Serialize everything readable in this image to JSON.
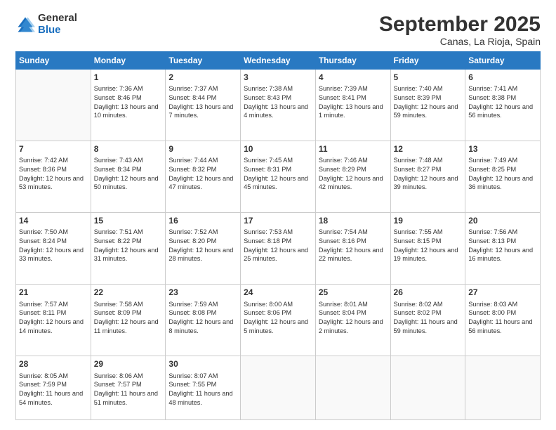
{
  "header": {
    "logo_general": "General",
    "logo_blue": "Blue",
    "title": "September 2025",
    "subtitle": "Canas, La Rioja, Spain"
  },
  "weekdays": [
    "Sunday",
    "Monday",
    "Tuesday",
    "Wednesday",
    "Thursday",
    "Friday",
    "Saturday"
  ],
  "weeks": [
    [
      {
        "day": "",
        "info": ""
      },
      {
        "day": "1",
        "info": "Sunrise: 7:36 AM\nSunset: 8:46 PM\nDaylight: 13 hours\nand 10 minutes."
      },
      {
        "day": "2",
        "info": "Sunrise: 7:37 AM\nSunset: 8:44 PM\nDaylight: 13 hours\nand 7 minutes."
      },
      {
        "day": "3",
        "info": "Sunrise: 7:38 AM\nSunset: 8:43 PM\nDaylight: 13 hours\nand 4 minutes."
      },
      {
        "day": "4",
        "info": "Sunrise: 7:39 AM\nSunset: 8:41 PM\nDaylight: 13 hours\nand 1 minute."
      },
      {
        "day": "5",
        "info": "Sunrise: 7:40 AM\nSunset: 8:39 PM\nDaylight: 12 hours\nand 59 minutes."
      },
      {
        "day": "6",
        "info": "Sunrise: 7:41 AM\nSunset: 8:38 PM\nDaylight: 12 hours\nand 56 minutes."
      }
    ],
    [
      {
        "day": "7",
        "info": "Sunrise: 7:42 AM\nSunset: 8:36 PM\nDaylight: 12 hours\nand 53 minutes."
      },
      {
        "day": "8",
        "info": "Sunrise: 7:43 AM\nSunset: 8:34 PM\nDaylight: 12 hours\nand 50 minutes."
      },
      {
        "day": "9",
        "info": "Sunrise: 7:44 AM\nSunset: 8:32 PM\nDaylight: 12 hours\nand 47 minutes."
      },
      {
        "day": "10",
        "info": "Sunrise: 7:45 AM\nSunset: 8:31 PM\nDaylight: 12 hours\nand 45 minutes."
      },
      {
        "day": "11",
        "info": "Sunrise: 7:46 AM\nSunset: 8:29 PM\nDaylight: 12 hours\nand 42 minutes."
      },
      {
        "day": "12",
        "info": "Sunrise: 7:48 AM\nSunset: 8:27 PM\nDaylight: 12 hours\nand 39 minutes."
      },
      {
        "day": "13",
        "info": "Sunrise: 7:49 AM\nSunset: 8:25 PM\nDaylight: 12 hours\nand 36 minutes."
      }
    ],
    [
      {
        "day": "14",
        "info": "Sunrise: 7:50 AM\nSunset: 8:24 PM\nDaylight: 12 hours\nand 33 minutes."
      },
      {
        "day": "15",
        "info": "Sunrise: 7:51 AM\nSunset: 8:22 PM\nDaylight: 12 hours\nand 31 minutes."
      },
      {
        "day": "16",
        "info": "Sunrise: 7:52 AM\nSunset: 8:20 PM\nDaylight: 12 hours\nand 28 minutes."
      },
      {
        "day": "17",
        "info": "Sunrise: 7:53 AM\nSunset: 8:18 PM\nDaylight: 12 hours\nand 25 minutes."
      },
      {
        "day": "18",
        "info": "Sunrise: 7:54 AM\nSunset: 8:16 PM\nDaylight: 12 hours\nand 22 minutes."
      },
      {
        "day": "19",
        "info": "Sunrise: 7:55 AM\nSunset: 8:15 PM\nDaylight: 12 hours\nand 19 minutes."
      },
      {
        "day": "20",
        "info": "Sunrise: 7:56 AM\nSunset: 8:13 PM\nDaylight: 12 hours\nand 16 minutes."
      }
    ],
    [
      {
        "day": "21",
        "info": "Sunrise: 7:57 AM\nSunset: 8:11 PM\nDaylight: 12 hours\nand 14 minutes."
      },
      {
        "day": "22",
        "info": "Sunrise: 7:58 AM\nSunset: 8:09 PM\nDaylight: 12 hours\nand 11 minutes."
      },
      {
        "day": "23",
        "info": "Sunrise: 7:59 AM\nSunset: 8:08 PM\nDaylight: 12 hours\nand 8 minutes."
      },
      {
        "day": "24",
        "info": "Sunrise: 8:00 AM\nSunset: 8:06 PM\nDaylight: 12 hours\nand 5 minutes."
      },
      {
        "day": "25",
        "info": "Sunrise: 8:01 AM\nSunset: 8:04 PM\nDaylight: 12 hours\nand 2 minutes."
      },
      {
        "day": "26",
        "info": "Sunrise: 8:02 AM\nSunset: 8:02 PM\nDaylight: 11 hours\nand 59 minutes."
      },
      {
        "day": "27",
        "info": "Sunrise: 8:03 AM\nSunset: 8:00 PM\nDaylight: 11 hours\nand 56 minutes."
      }
    ],
    [
      {
        "day": "28",
        "info": "Sunrise: 8:05 AM\nSunset: 7:59 PM\nDaylight: 11 hours\nand 54 minutes."
      },
      {
        "day": "29",
        "info": "Sunrise: 8:06 AM\nSunset: 7:57 PM\nDaylight: 11 hours\nand 51 minutes."
      },
      {
        "day": "30",
        "info": "Sunrise: 8:07 AM\nSunset: 7:55 PM\nDaylight: 11 hours\nand 48 minutes."
      },
      {
        "day": "",
        "info": ""
      },
      {
        "day": "",
        "info": ""
      },
      {
        "day": "",
        "info": ""
      },
      {
        "day": "",
        "info": ""
      }
    ]
  ]
}
